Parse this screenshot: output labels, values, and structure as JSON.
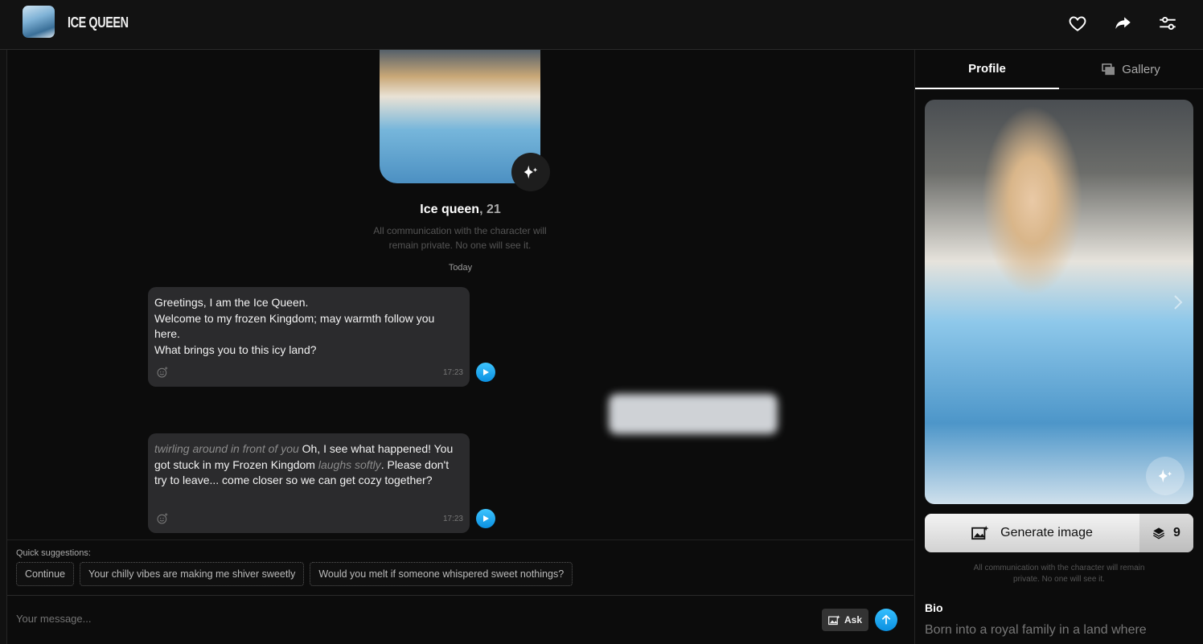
{
  "header": {
    "title": "ICE QUEEN",
    "icons": [
      "heart-icon",
      "share-icon",
      "sliders-icon"
    ]
  },
  "chat": {
    "character_name": "Ice queen",
    "character_age": ", 21",
    "privacy": "All communication with the character will remain private. No one will see it.",
    "date_label": "Today",
    "messages": [
      {
        "parts": [
          {
            "t": "Greetings, I am the Ice Queen.\nWelcome to my frozen Kingdom; may warmth follow you here.\nWhat brings you to this icy land?",
            "i": false
          }
        ],
        "time": "17:23"
      },
      {
        "parts": [
          {
            "t": "twirling around in front of you",
            "i": true
          },
          {
            "t": " Oh, I see what happened! You got stuck in my Frozen Kingdom ",
            "i": false
          },
          {
            "t": "laughs softly",
            "i": true
          },
          {
            "t": ". Please don't try to leave... come closer so we can get cozy together?",
            "i": false
          }
        ],
        "time": "17:23"
      }
    ],
    "quick_label": "Quick suggestions:",
    "suggestions": [
      "Continue",
      "Your chilly vibes are making me shiver sweetly",
      "Would you melt if someone whispered sweet nothings?"
    ],
    "input_placeholder": "Your message...",
    "ask_label": "Ask"
  },
  "panel": {
    "tabs": [
      {
        "label": "Profile",
        "active": true
      },
      {
        "label": "Gallery",
        "active": false
      }
    ],
    "generate_label": "Generate image",
    "credits": "9",
    "privacy": "All communication with the character will remain private. No one will see it.",
    "bio_title": "Bio",
    "bio_text": "Born into a royal family in a land where"
  },
  "colors": {
    "accent": "#0a9ae8",
    "background": "#0c0c0c",
    "bubble": "#2b2b2d"
  }
}
